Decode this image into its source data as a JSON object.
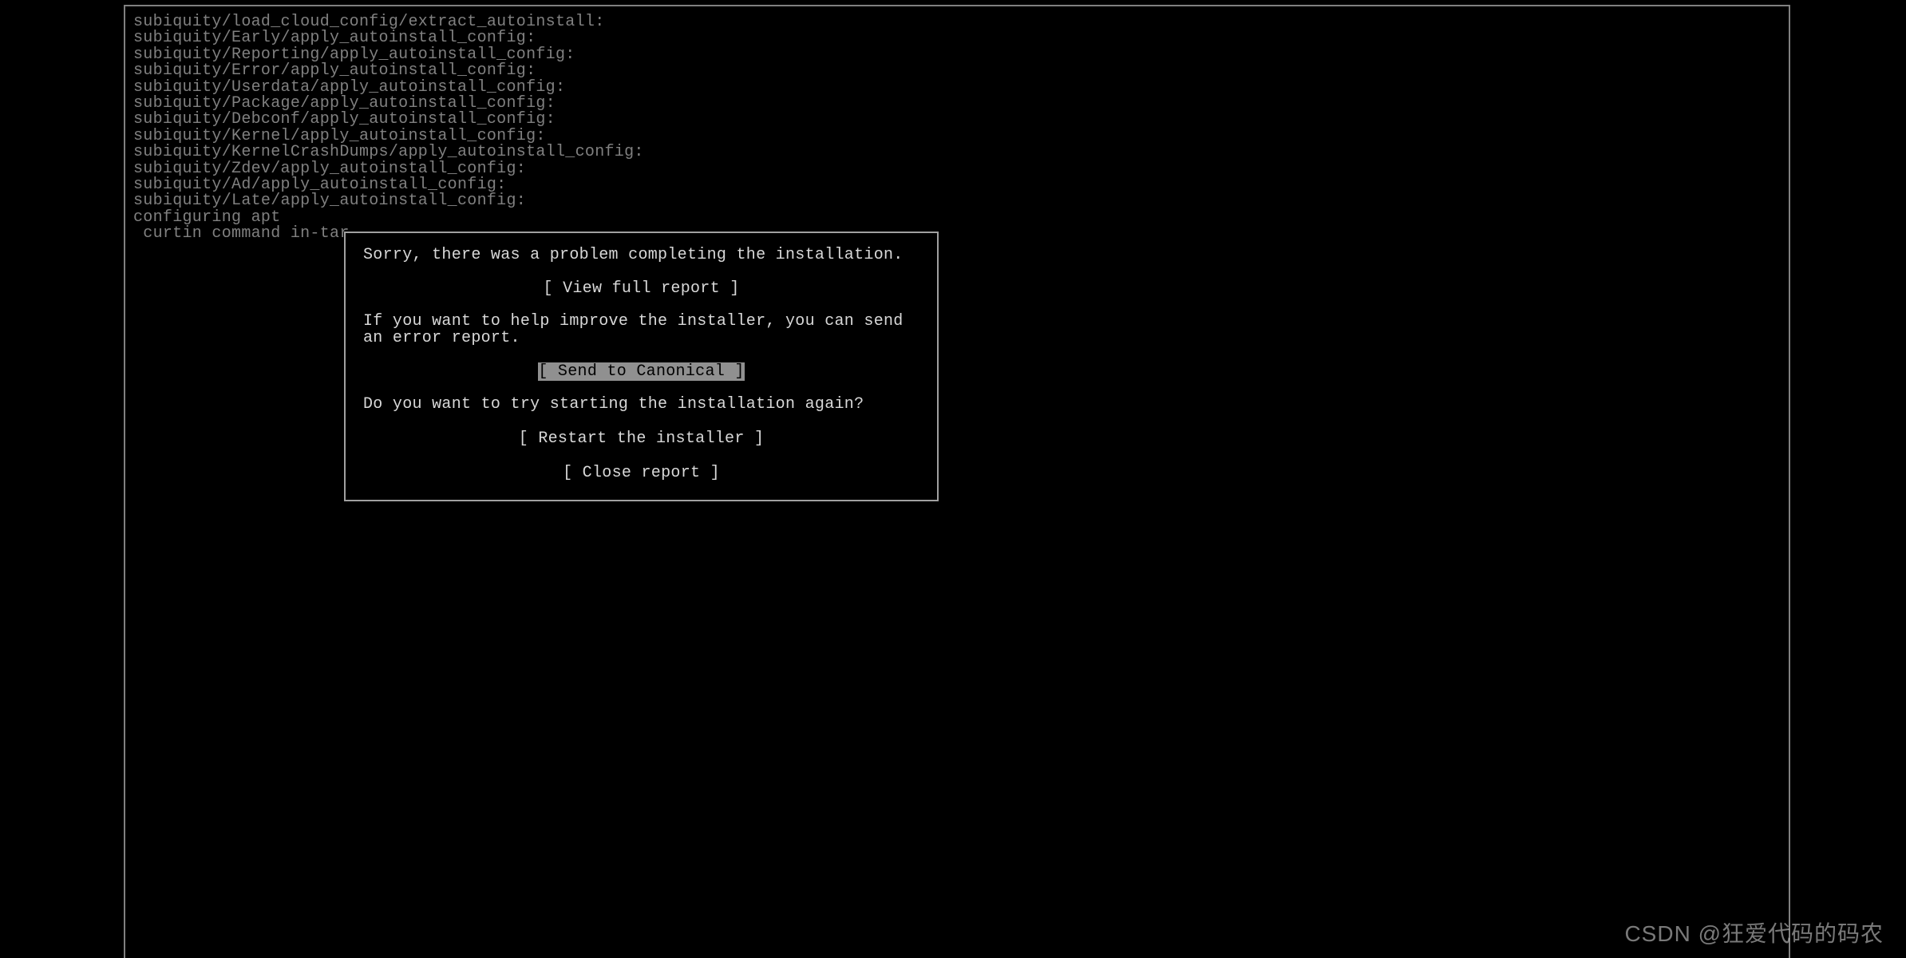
{
  "log_lines": [
    "subiquity/load_cloud_config/extract_autoinstall:",
    "subiquity/Early/apply_autoinstall_config:",
    "subiquity/Reporting/apply_autoinstall_config:",
    "subiquity/Error/apply_autoinstall_config:",
    "subiquity/Userdata/apply_autoinstall_config:",
    "subiquity/Package/apply_autoinstall_config:",
    "subiquity/Debconf/apply_autoinstall_config:",
    "subiquity/Kernel/apply_autoinstall_config:",
    "subiquity/KernelCrashDumps/apply_autoinstall_config:",
    "subiquity/Zdev/apply_autoinstall_config:",
    "subiquity/Ad/apply_autoinstall_config:",
    "subiquity/Late/apply_autoinstall_config:",
    "configuring apt",
    " curtin command in-tar"
  ],
  "dialog": {
    "message1": "Sorry, there was a problem completing the installation.",
    "button_view_report": "[ View full report      ]",
    "message2": "If you want to help improve the installer, you can send an error report.",
    "button_send": "[ Send to Canonical     ]",
    "message3": "Do you want to try starting the installation again?",
    "button_restart": "[ Restart the installer ]",
    "button_close": "[ Close report          ]"
  },
  "watermark": "CSDN @狂爱代码的码农"
}
